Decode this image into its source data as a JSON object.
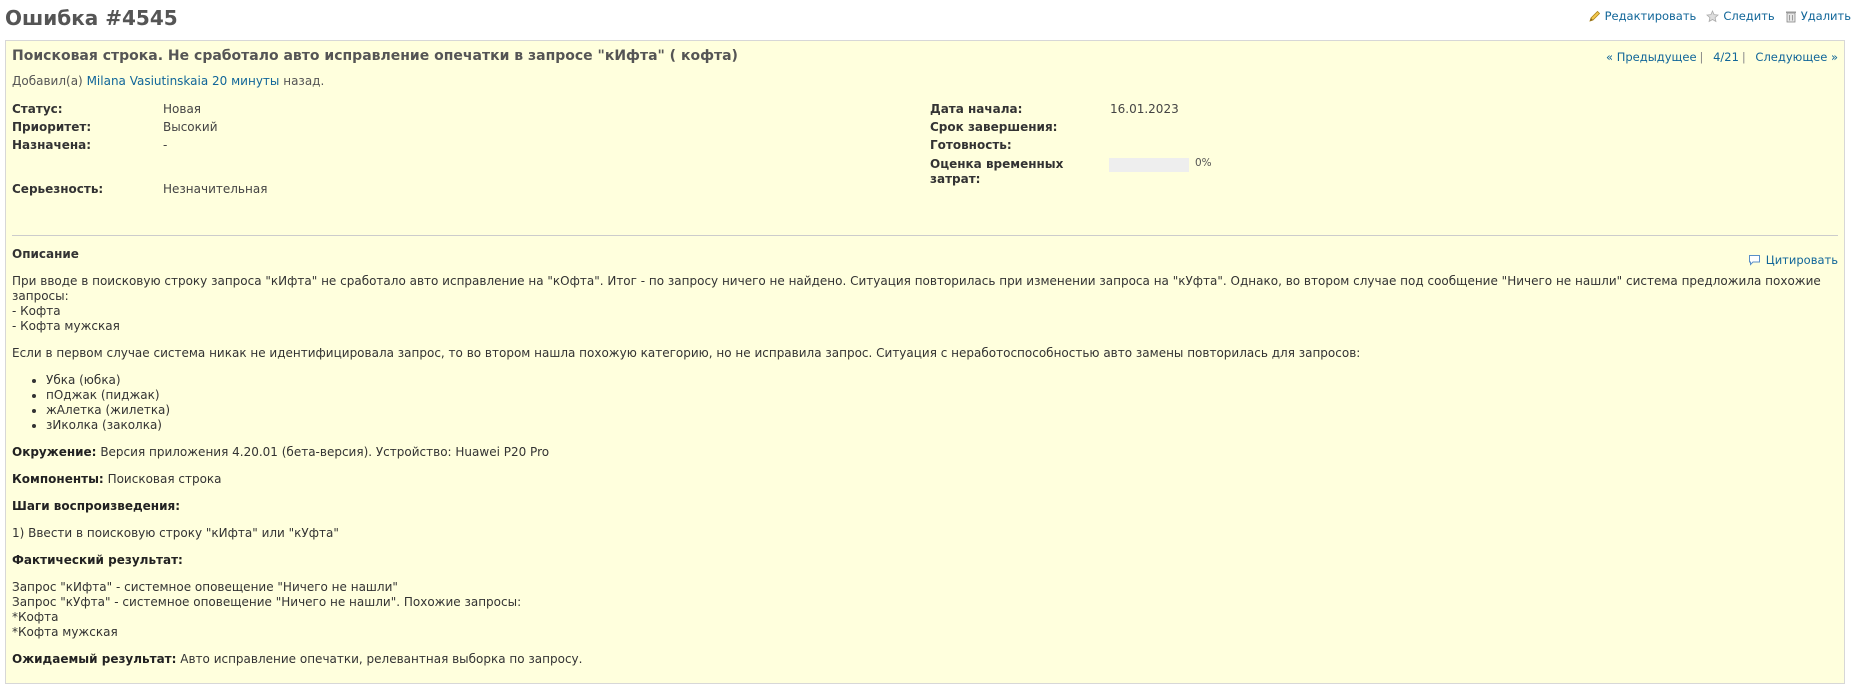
{
  "title": "Ошибка #4545",
  "actions": {
    "edit": "Редактировать",
    "watch": "Следить",
    "delete": "Удалить"
  },
  "issue": {
    "subject": "Поисковая строка. Не сработало авто исправление опечатки в запросе \"кИфта\" ( кофта)",
    "author_prefix": "Добавил(а)",
    "author": "Milana Vasiutinskaia",
    "time": "20 минуты",
    "time_suffix": "назад.",
    "nav": {
      "prev": "« Предыдущее",
      "position": "4/21",
      "next": "Следующее »"
    }
  },
  "attributes": {
    "status": {
      "label": "Статус:",
      "value": "Новая"
    },
    "priority": {
      "label": "Приоритет:",
      "value": "Высокий"
    },
    "assigned": {
      "label": "Назначена:",
      "value": "-"
    },
    "severity": {
      "label": "Серьезность:",
      "value": "Незначительная"
    },
    "start_date": {
      "label": "Дата начала:",
      "value": "16.01.2023"
    },
    "due_date": {
      "label": "Срок завершения:",
      "value": ""
    },
    "done": {
      "label": "Готовность:",
      "value": "0%",
      "percent": 0
    },
    "estimate": {
      "label_1": "Оценка временных",
      "label_2": "затрат:",
      "value": ""
    }
  },
  "description": {
    "title": "Описание",
    "quote_label": "Цитировать",
    "intro_1": "При вводе в поисковую строку запроса \"кИфта\" не сработало авто исправление на \"кОфта\". Итог - по запросу ничего не найдено. Ситуация повторилась при изменении запроса на \"кУфта\". Однако, во втором случае под сообщение \"Ничего не нашли\" система предложила похожие",
    "intro_2": "запросы:",
    "intro_3": "- Кофта",
    "intro_4": "- Кофта мужская",
    "para_2": "Если в первом случае система никак не идентифицировала запрос, то во втором нашла похожую категорию, но не исправила запрос. Ситуация с неработоспособностью авто замены повторилась для запросов:",
    "list": [
      "Убка (юбка)",
      "пОджак (пиджак)",
      "жАлетка (жилетка)",
      "зИколка (заколка)"
    ],
    "env_label": "Окружение:",
    "env_value": "Версия приложения 4.20.01 (бета-версия). Устройство: Huawei P20 Pro",
    "components_label": "Компоненты:",
    "components_value": "Поисковая строка",
    "steps_label": "Шаги воспроизведения:",
    "step_1": "1) Ввести в поисковую строку \"кИфта\" или \"кУфта\"",
    "actual_label": "Фактический результат:",
    "actual_1": "Запрос \"кИфта\" - системное оповещение \"Ничего не нашли\"",
    "actual_2": "Запрос \"кУфта\" - системное оповещение \"Ничего не нашли\". Похожие запросы:",
    "actual_3": "*Кофта",
    "actual_4": "*Кофта мужская",
    "expected_label": "Ожидаемый результат:",
    "expected_value": "Авто исправление опечатки, релевантная выборка по запросу."
  },
  "colors": {
    "link": "#116699",
    "box_bg": "#ffffdd",
    "progress_bg": "#eeeeee"
  },
  "icons": {
    "edit": "pencil-icon",
    "watch": "star-icon",
    "delete": "trash-icon",
    "quote": "speech-bubble-icon"
  }
}
